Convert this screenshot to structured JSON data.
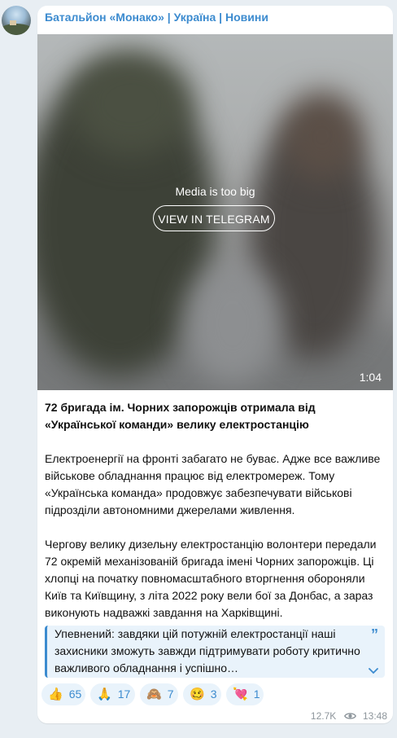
{
  "channel": {
    "name": "Батальйон «Монако» | Україна | Новини"
  },
  "media": {
    "status": "Media is too big",
    "button_label": "VIEW IN TELEGRAM",
    "duration": "1:04"
  },
  "post": {
    "title": "72 бригада ім. Чорних запорожців отримала від «Української команди» велику електростанцію",
    "paragraph1": "Електроенергії на фронті забагато не буває. Адже все важливе військове обладнання працює від електромереж. Тому «Українська команда» продовжує забезпечувати військові підрозділи автономними джерелами живлення.",
    "paragraph2": "Чергову велику дизельну електростанцію волонтери передали 72 окремій механізованій бригада імені Чорних запорожців. Ці хлопці на початку повномасштабного вторгнення обороняли Київ та Київщину, з літа 2022 року вели бої за Донбас, а зараз виконують надважкі завдання на Харківщині.",
    "quote": "Упевнений: завдяки цій потужній електростанції наші захисники зможуть завжди підтримувати роботу критично важливого обладнання і успішно…"
  },
  "reactions": [
    {
      "emoji": "👍",
      "count": "65"
    },
    {
      "emoji": "🙏",
      "count": "17"
    },
    {
      "emoji": "🙈",
      "count": "7"
    },
    {
      "emoji": "🥴",
      "count": "3"
    },
    {
      "emoji": "💘",
      "count": "1"
    }
  ],
  "footer": {
    "views": "12.7K",
    "time": "13:48"
  },
  "colors": {
    "accent": "#3c8bcf",
    "background": "#e8eef3",
    "quote_bg": "#e9f3fb"
  }
}
